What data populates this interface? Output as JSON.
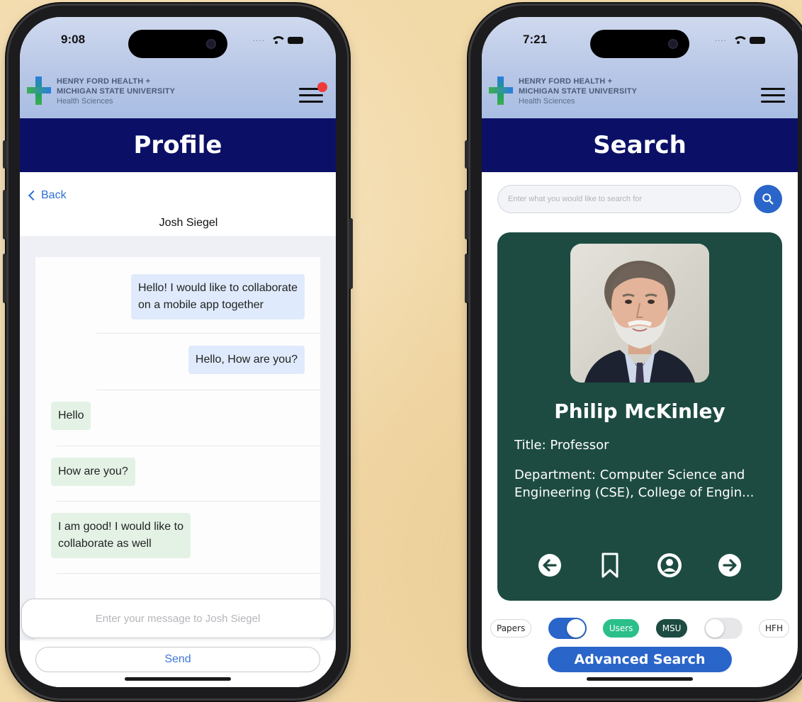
{
  "left_phone": {
    "status_time": "9:08",
    "logo": {
      "line1": "HENRY FORD HEALTH +",
      "line2": "MICHIGAN STATE UNIVERSITY",
      "line3": "Health Sciences"
    },
    "menu_has_notification": true,
    "page_title": "Profile",
    "back_label": "Back",
    "contact_name": "Josh Siegel",
    "messages": [
      {
        "direction": "out",
        "lines": [
          "Hello! I would like to collaborate",
          "on a mobile app together"
        ]
      },
      {
        "direction": "out",
        "lines": [
          "Hello, How are you?"
        ]
      },
      {
        "direction": "in",
        "lines": [
          "Hello"
        ]
      },
      {
        "direction": "in",
        "lines": [
          "How are you?"
        ]
      },
      {
        "direction": "in",
        "lines": [
          "I am good! I would like to",
          "collaborate as well"
        ]
      }
    ],
    "input_placeholder": "Enter your message to Josh Siegel",
    "send_label": "Send"
  },
  "right_phone": {
    "status_time": "7:21",
    "logo": {
      "line1": "HENRY FORD HEALTH +",
      "line2": "MICHIGAN STATE UNIVERSITY",
      "line3": "Health Sciences"
    },
    "page_title": "Search",
    "search_placeholder": "Enter what you would like to search for",
    "result": {
      "name": "Philip McKinley",
      "title": "Title: Professor",
      "department": "Department: Computer Science and Engineering (CSE), College of Engin..."
    },
    "actions": [
      "arrow-left-icon",
      "bookmark-icon",
      "profile-icon",
      "arrow-right-icon"
    ],
    "filters": {
      "papers_label": "Papers",
      "papers_users_toggle_on": true,
      "users_label": "Users",
      "msu_label": "MSU",
      "msu_hfh_toggle_on": false,
      "hfh_label": "HFH"
    },
    "advanced_search_label": "Advanced Search"
  },
  "colors": {
    "title_band": "#0b1066",
    "card_bg": "#1d4b41",
    "accent_blue": "#2a65c9",
    "users_chip": "#2bbf8a",
    "outgoing_bubble": "#dfeafc",
    "incoming_bubble": "#e4f2e6",
    "background": "#f2d9a8"
  }
}
